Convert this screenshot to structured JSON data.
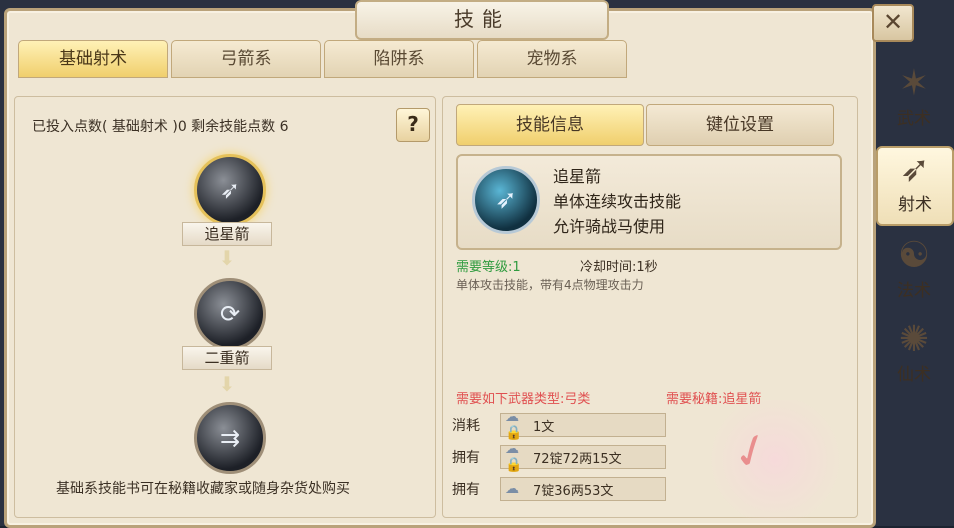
{
  "window": {
    "title": "技能",
    "close_label": "✕"
  },
  "tabs": [
    "基础射术",
    "弓箭系",
    "陷阱系",
    "宠物系"
  ],
  "side_nav": [
    {
      "label": "武术",
      "icon": "martial-icon"
    },
    {
      "label": "射术",
      "icon": "archery-icon",
      "active": true
    },
    {
      "label": "法术",
      "icon": "spell-icon"
    },
    {
      "label": "仙术",
      "icon": "immortal-icon"
    }
  ],
  "points_info": "已投入点数( 基础射术 )0    剩余技能点数 6",
  "help_button": "?",
  "skill_tree": [
    {
      "name": "追星箭"
    },
    {
      "name": "二重箭"
    },
    {
      "name": ""
    }
  ],
  "bottom_note": "基础系技能书可在秘籍收藏家或随身杂货处购买",
  "right_tabs": [
    "技能信息",
    "键位设置"
  ],
  "skill_info": {
    "name": "追星箭",
    "line1": "单体连续攻击技能",
    "line2": "允许骑战马使用",
    "req_level": "需要等级:1",
    "cooldown": "冷却时间:1秒",
    "description": "单体攻击技能，带有4点物理攻击力",
    "weapon_req": "需要如下武器类型:弓类",
    "book_req": "需要秘籍:追星箭"
  },
  "costs": [
    {
      "label": "消耗",
      "value": "1文"
    },
    {
      "label": "拥有",
      "value": "72锭72两15文"
    },
    {
      "label": "拥有",
      "value": "7锭36两53文"
    }
  ]
}
